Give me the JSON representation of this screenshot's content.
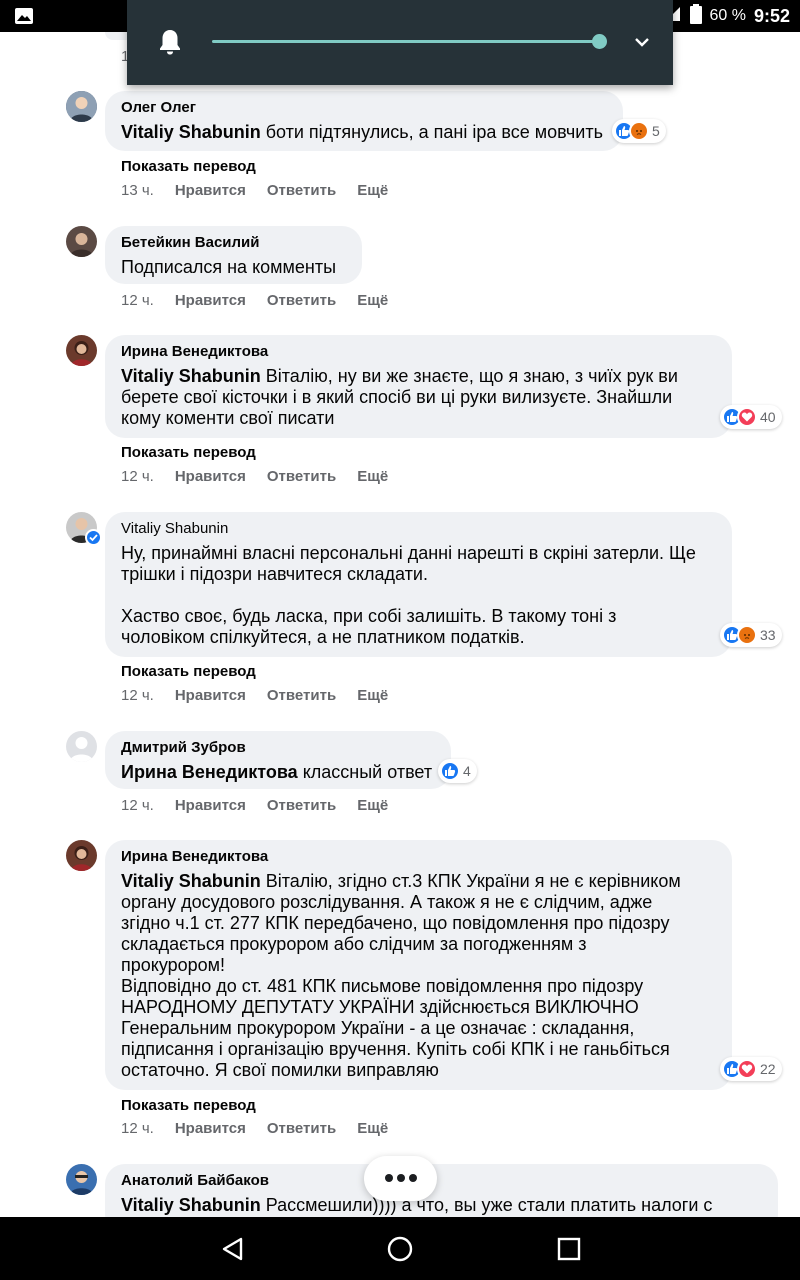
{
  "status_bar": {
    "battery": "60 %",
    "time": "9:52"
  },
  "volume_panel": {
    "level": 0.97
  },
  "partial_comment": {
    "time_fragment": "1"
  },
  "comments": [
    {
      "author": "Олег Олег",
      "mention": "Vitaliy Shabunin",
      "text": " боти підтянулись, а пані іра все мовчить",
      "reaction_count": "5",
      "translate": "Показать перевод",
      "time": "13 ч.",
      "like": "Нравится",
      "reply": "Ответить",
      "more": "Ещё"
    },
    {
      "author": "Бетейкин Василий",
      "mention": "",
      "text": "Подписался на комменты",
      "time": "12 ч.",
      "like": "Нравится",
      "reply": "Ответить",
      "more": "Ещё"
    },
    {
      "author": "Ирина Венедиктова",
      "mention": "Vitaliy Shabunin",
      "text_lines": [
        " Віталію, ну ви же знаєте, що я знаю, з чиїх рук ви",
        "берете свої кісточки і в який спосіб ви ці руки вилизуєте. Знайшли",
        "кому коменти свої писати"
      ],
      "reaction_count": "40",
      "translate": "Показать перевод",
      "time": "12 ч.",
      "like": "Нравится",
      "reply": "Ответить",
      "more": "Ещё"
    },
    {
      "author": "Vitaliy Shabunin",
      "para1": [
        "Ну, принаймні власні персональні данні нарешті в скріні затерли. Ще",
        "трішки і підозри навчитеся складати."
      ],
      "para2": [
        "Хаство своє, будь ласка, при собі залишіть. В такому тоні з",
        "чоловіком спілкуйтеся, а не платником податків."
      ],
      "reaction_count": "33",
      "translate": "Показать перевод",
      "time": "12 ч.",
      "like": "Нравится",
      "reply": "Ответить",
      "more": "Ещё"
    },
    {
      "author": "Дмитрий Зубров",
      "mention": "Ирина Венедиктова",
      "text": " классный ответ",
      "reaction_count": "4",
      "time": "12 ч.",
      "like": "Нравится",
      "reply": "Ответить",
      "more": "Ещё"
    },
    {
      "author": "Ирина Венедиктова",
      "mention": "Vitaliy Shabunin",
      "text_lines": [
        " Віталію, згідно ст.3 КПК України я не є керівником",
        "органу досудового розслідування. А також я не є слідчим, адже",
        "згідно ч.1 ст. 277 КПК передбачено, що повідомлення про підозру",
        "складається прокурором або слідчим за погодженням з",
        "прокурором!",
        "Відповідно до ст. 481 КПК письмове повідомлення про підозру",
        "НАРОДНОМУ ДЕПУТАТУ УКРАЇНИ здійснюється ВИКЛЮЧНО",
        "Генеральним прокурором України - а це означає : складання,",
        "підписання і організацію вручення. Купіть собі КПК і не ганьбіться",
        "остаточно. Я свої помилки виправляю"
      ],
      "reaction_count": "22",
      "translate": "Показать перевод",
      "time": "12 ч.",
      "like": "Нравится",
      "reply": "Ответить",
      "more": "Ещё"
    },
    {
      "author": "Анатолий Байбаков",
      "mention": "Vitaliy Shabunin",
      "text": " Рассмешили)))) а что, вы уже стали платить налоги с"
    }
  ]
}
